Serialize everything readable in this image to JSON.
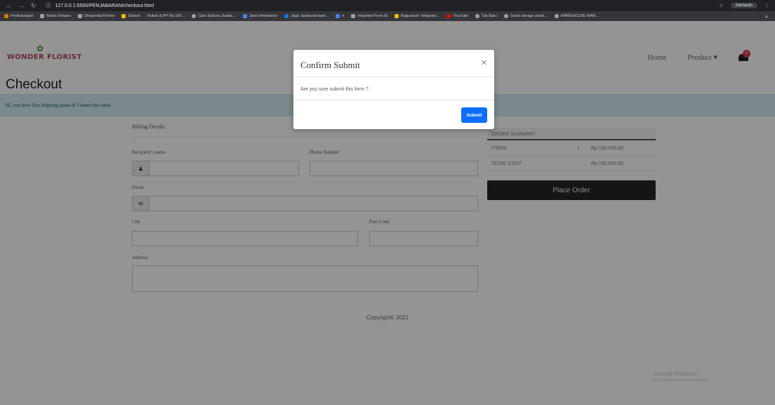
{
  "browser": {
    "url": "127.0.0.1:5500/PENJABARAN/checkout.html",
    "profile": "Samaran",
    "bookmarks": [
      "Perlindungan",
      "Berita Terbaru",
      "Dimpordai Firefox",
      "Search",
      "Rokok & PP No.109...",
      "Cara Sukses Jualan...",
      "Java Inheritance",
      "Jago Jualan bersam...",
      "n",
      "Imported From IE",
      "Bagusever Telegram...",
      "YouTube",
      "Tab Baru",
      "Good storage practi...",
      "WAREHOUSE MAN..."
    ],
    "more": "»"
  },
  "site": {
    "logo": "WONDER FLORIST",
    "nav": {
      "home": "Home",
      "product": "Product ▾",
      "cart_count": "0"
    }
  },
  "page": {
    "title": "Checkout",
    "alert": "Hi, you have free shipping quota of 3 times this week",
    "billing": {
      "title": "Billing Details",
      "recipient_label": "Recipient's name",
      "phone_label": "Phone Number",
      "email_label": "Email",
      "city_label": "City",
      "postcode_label": "Post Code",
      "address_label": "Address"
    },
    "summary": {
      "header": "ORDER SUMMARY",
      "items_label": "ITEMS",
      "items_qty": "1",
      "items_price": "Rp 150.000,00",
      "total_label": "TOTAL COST",
      "total_price": "Rp 150.000,00",
      "place_order": "Place Order"
    },
    "footer": "Copyright© 2021",
    "watermark": {
      "title": "Activate Windows",
      "sub": "Go to Settings to activate Windows."
    }
  },
  "modal": {
    "title": "Confirm Submit",
    "close": "×",
    "body": "Are you sure submit this form ?",
    "submit": "Submit"
  },
  "colors": {
    "alert_bg": "#d1ecf1",
    "submit_button": "#0d6efd",
    "place_order_bg": "#212529",
    "cart_badge": "#dc3545"
  }
}
